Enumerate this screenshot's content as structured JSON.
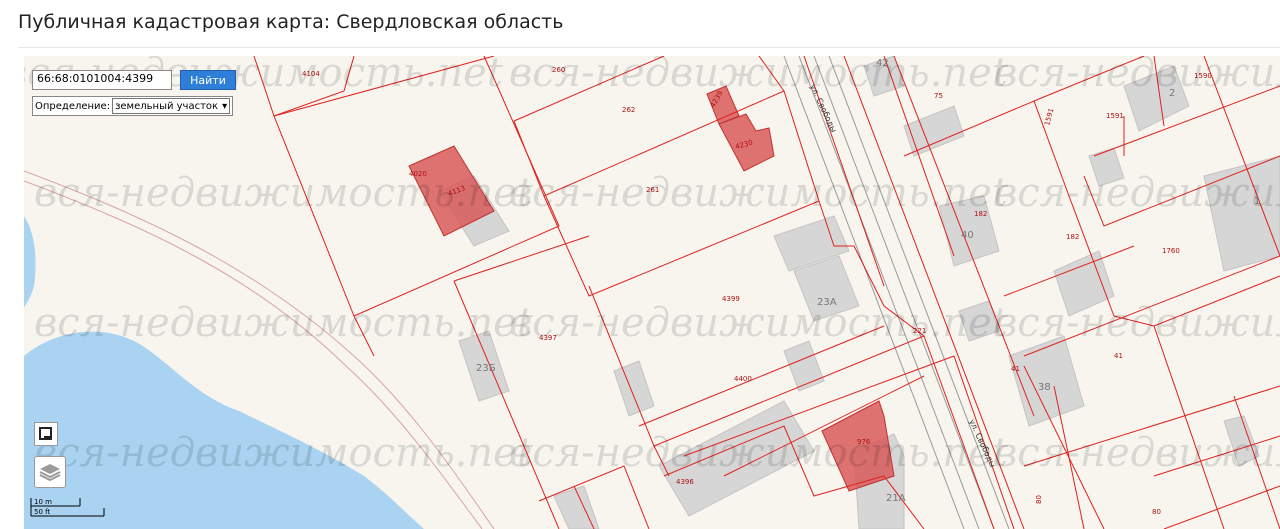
{
  "page": {
    "title": "Публичная кадастровая карта: Свердловская область"
  },
  "search": {
    "value": "66:68:0101004:4399",
    "button_label": "Найти"
  },
  "definition": {
    "label": "Определение:",
    "selected": "земельный участок",
    "chevron": "▾"
  },
  "controls": {
    "fullscreen_icon": "fullscreen-icon",
    "layers_icon": "layers-icon"
  },
  "scale": {
    "metric": "10 m",
    "imperial": "50 ft"
  },
  "watermark": "вся-недвижимость.net",
  "streets": [
    {
      "name": "ул. Свободы"
    },
    {
      "name": "ул. Свободы"
    }
  ],
  "parcels": [
    "4104",
    "260",
    "262",
    "4239",
    "4230",
    "4020",
    "4113",
    "261",
    "4399",
    "4397",
    "4400",
    "976",
    "4396",
    "75",
    "1591",
    "1590",
    "1591",
    "182",
    "182",
    "1760",
    "221",
    "41",
    "41",
    "80",
    "80"
  ],
  "buildings": [
    "42",
    "2",
    "40",
    "23А",
    "23Б",
    "38",
    "21А",
    "1"
  ],
  "colors": {
    "parcel_line": "#e0201c",
    "parcel_fill": "#d85a5a",
    "water": "#a9d3f1",
    "building": "#d9d9d9",
    "background": "#f7f5ee",
    "button": "#2f7fd8"
  }
}
